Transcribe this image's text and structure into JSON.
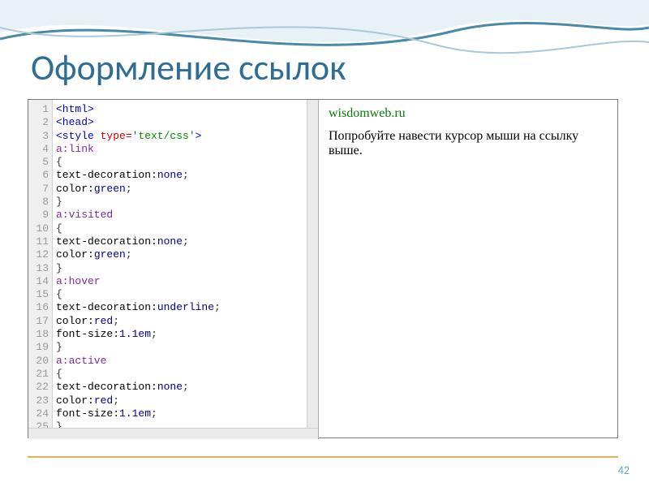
{
  "title": "Оформление ссылок",
  "page_number": "42",
  "preview": {
    "link_text": "wisdomweb.ru",
    "body_text": "Попробуйте навести курсор мыши на ссылку выше."
  },
  "code": {
    "line_count": 25,
    "lines": [
      [
        {
          "c": "t-tag",
          "t": "<html>"
        }
      ],
      [
        {
          "c": "t-tag",
          "t": "<head>"
        }
      ],
      [
        {
          "c": "t-tag",
          "t": "<style "
        },
        {
          "c": "t-attr",
          "t": "type="
        },
        {
          "c": "t-val",
          "t": "'text/css'"
        },
        {
          "c": "t-tag",
          "t": ">"
        }
      ],
      [
        {
          "c": "t-sel",
          "t": "a:link"
        }
      ],
      [
        {
          "c": "t-punc",
          "t": "{"
        }
      ],
      [
        {
          "c": "t-prop",
          "t": "text-decoration:"
        },
        {
          "c": "t-kw",
          "t": "none"
        },
        {
          "c": "t-punc",
          "t": ";"
        }
      ],
      [
        {
          "c": "t-prop",
          "t": "color:"
        },
        {
          "c": "t-kw",
          "t": "green"
        },
        {
          "c": "t-punc",
          "t": ";"
        }
      ],
      [
        {
          "c": "t-punc",
          "t": "}"
        }
      ],
      [
        {
          "c": "t-sel",
          "t": "a:visited"
        }
      ],
      [
        {
          "c": "t-punc",
          "t": "{"
        }
      ],
      [
        {
          "c": "t-prop",
          "t": "text-decoration:"
        },
        {
          "c": "t-kw",
          "t": "none"
        },
        {
          "c": "t-punc",
          "t": ";"
        }
      ],
      [
        {
          "c": "t-prop",
          "t": "color:"
        },
        {
          "c": "t-kw",
          "t": "green"
        },
        {
          "c": "t-punc",
          "t": ";"
        }
      ],
      [
        {
          "c": "t-punc",
          "t": "}"
        }
      ],
      [
        {
          "c": "t-sel",
          "t": "a:hover"
        }
      ],
      [
        {
          "c": "t-punc",
          "t": "{"
        }
      ],
      [
        {
          "c": "t-prop",
          "t": "text-decoration:"
        },
        {
          "c": "t-kw",
          "t": "underline"
        },
        {
          "c": "t-punc",
          "t": ";"
        }
      ],
      [
        {
          "c": "t-prop",
          "t": "color:"
        },
        {
          "c": "t-kw",
          "t": "red"
        },
        {
          "c": "t-punc",
          "t": ";"
        }
      ],
      [
        {
          "c": "t-prop",
          "t": "font-size:"
        },
        {
          "c": "t-kw",
          "t": "1.1em"
        },
        {
          "c": "t-punc",
          "t": ";"
        }
      ],
      [
        {
          "c": "t-punc",
          "t": "}"
        }
      ],
      [
        {
          "c": "t-sel",
          "t": "a:active"
        }
      ],
      [
        {
          "c": "t-punc",
          "t": "{"
        }
      ],
      [
        {
          "c": "t-prop",
          "t": "text-decoration:"
        },
        {
          "c": "t-kw",
          "t": "none"
        },
        {
          "c": "t-punc",
          "t": ";"
        }
      ],
      [
        {
          "c": "t-prop",
          "t": "color:"
        },
        {
          "c": "t-kw",
          "t": "red"
        },
        {
          "c": "t-punc",
          "t": ";"
        }
      ],
      [
        {
          "c": "t-prop",
          "t": "font-size:"
        },
        {
          "c": "t-kw",
          "t": "1.1em"
        },
        {
          "c": "t-punc",
          "t": ";"
        }
      ],
      [
        {
          "c": "t-punc",
          "t": "}"
        }
      ]
    ]
  }
}
